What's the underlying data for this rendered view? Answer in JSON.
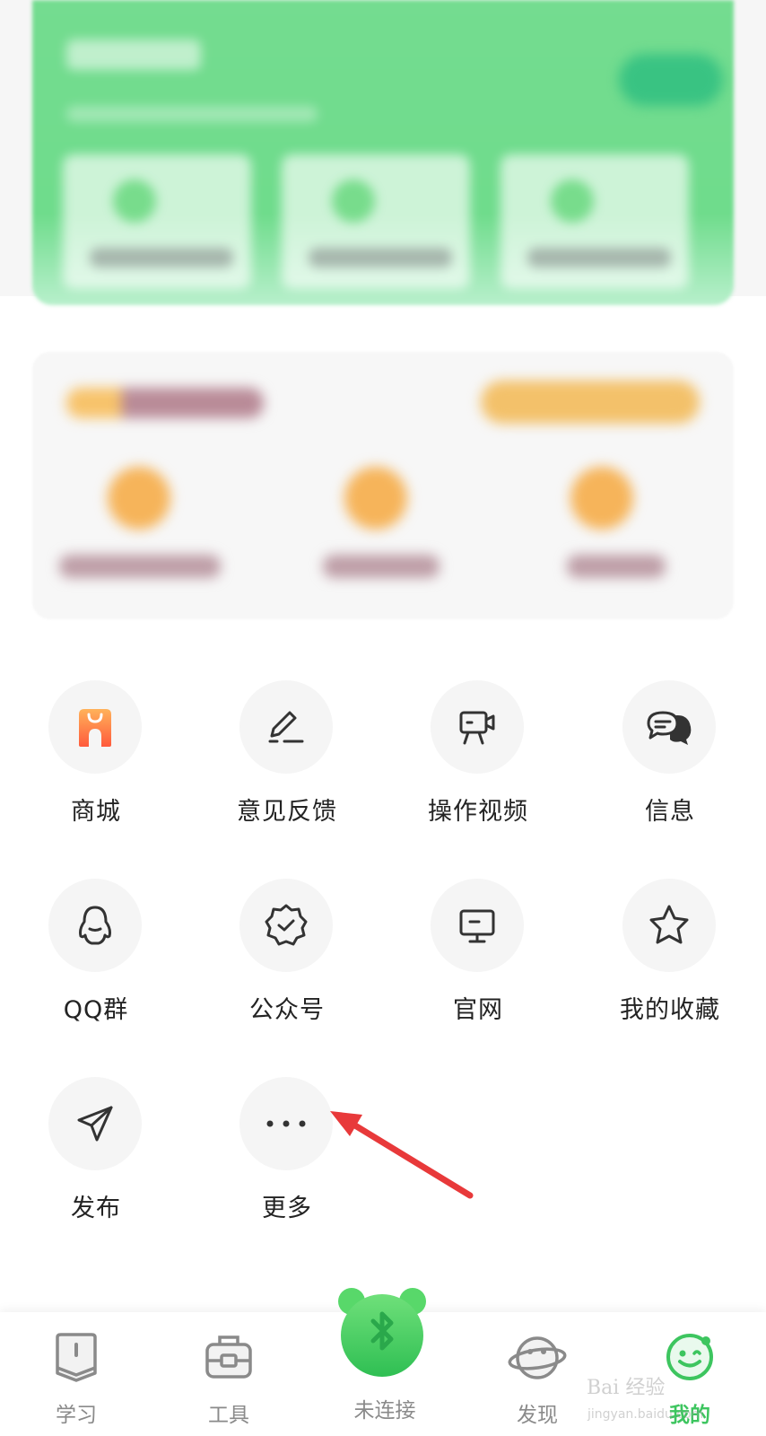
{
  "grid": {
    "items": [
      {
        "label": "商城",
        "icon": "shop-bag-icon"
      },
      {
        "label": "意见反馈",
        "icon": "feedback-pen-icon"
      },
      {
        "label": "操作视频",
        "icon": "video-camera-icon"
      },
      {
        "label": "信息",
        "icon": "chat-bubbles-icon"
      },
      {
        "label": "QQ群",
        "icon": "qq-penguin-icon"
      },
      {
        "label": "公众号",
        "icon": "badge-check-icon"
      },
      {
        "label": "官网",
        "icon": "monitor-icon"
      },
      {
        "label": "我的收藏",
        "icon": "star-icon"
      },
      {
        "label": "发布",
        "icon": "paper-plane-icon"
      },
      {
        "label": "更多",
        "icon": "more-dots-icon"
      }
    ]
  },
  "tabbar": {
    "study": "学习",
    "tools": "工具",
    "connect": "未连接",
    "discover": "发现",
    "mine": "我的"
  },
  "colors": {
    "accent_green": "#3dc55f",
    "shop_orange": "#ff8f3e",
    "arrow_red": "#e8393a"
  },
  "watermark": {
    "brand": "Bai 经验",
    "url": "jingyan.baidu.com"
  }
}
